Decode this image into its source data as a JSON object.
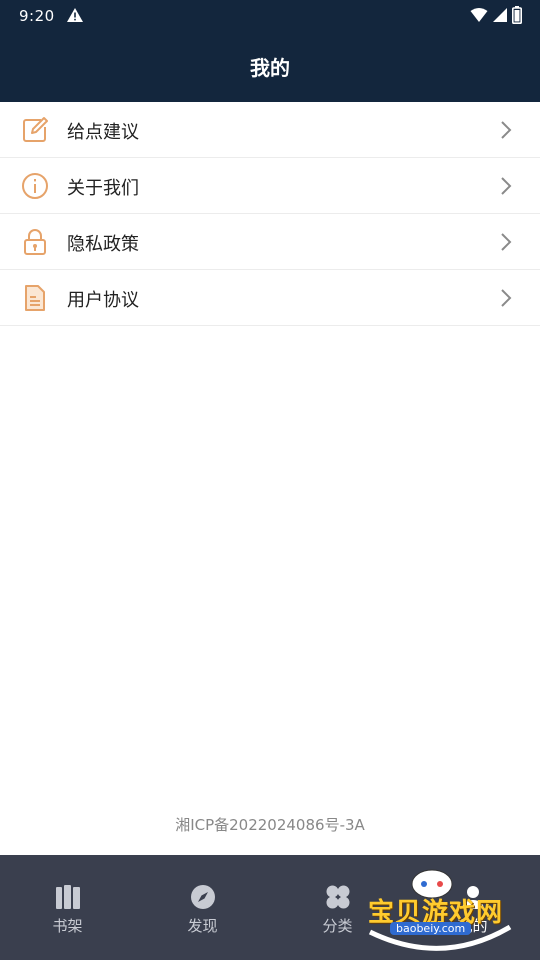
{
  "status_bar": {
    "time": "9:20"
  },
  "header": {
    "title": "我的"
  },
  "menu": [
    {
      "label": "给点建议",
      "icon": "edit-icon"
    },
    {
      "label": "关于我们",
      "icon": "info-icon"
    },
    {
      "label": "隐私政策",
      "icon": "lock-icon"
    },
    {
      "label": "用户协议",
      "icon": "document-icon"
    }
  ],
  "footer": {
    "icp": "湘ICP备2022024086号-3A"
  },
  "tabs": [
    {
      "label": "书架",
      "icon": "bookshelf-icon"
    },
    {
      "label": "发现",
      "icon": "compass-icon"
    },
    {
      "label": "分类",
      "icon": "category-icon"
    },
    {
      "label": "我的",
      "icon": "profile-icon"
    }
  ],
  "watermark": {
    "title": "宝贝游戏网",
    "url": "baobeiy.com"
  },
  "colors": {
    "header_bg": "#13263d",
    "accent": "#e6a36a",
    "tabbar_bg": "#3a3f4e"
  }
}
